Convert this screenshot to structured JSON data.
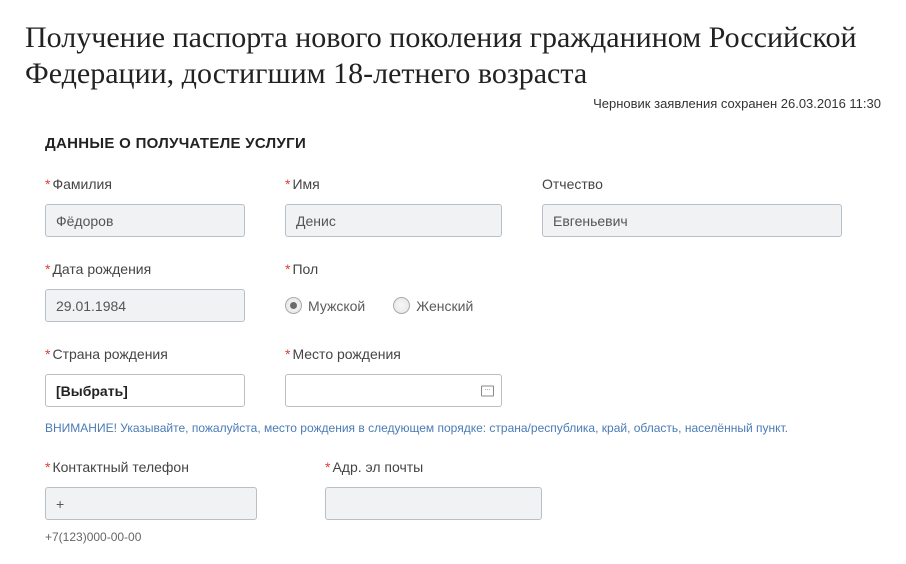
{
  "header": {
    "title": "Получение паспорта нового поколения гражданином Российской Федерации, достигшим 18-летнего возраста",
    "saved_note": "Черновик заявления сохранен 26.03.2016 11:30"
  },
  "section": {
    "title": "ДАННЫЕ О ПОЛУЧАТЕЛЕ УСЛУГИ"
  },
  "fields": {
    "surname": {
      "label": "Фамилия",
      "value": "Фёдоров"
    },
    "name": {
      "label": "Имя",
      "value": "Денис"
    },
    "patronymic": {
      "label": "Отчество",
      "value": "Евгеньевич"
    },
    "dob": {
      "label": "Дата рождения",
      "value": "29.01.1984"
    },
    "gender": {
      "label": "Пол",
      "options": {
        "male": "Мужской",
        "female": "Женский"
      },
      "value": "male"
    },
    "birth_country": {
      "label": "Страна рождения",
      "value": "[Выбрать]"
    },
    "birth_place": {
      "label": "Место рождения",
      "value": ""
    },
    "phone": {
      "label": "Контактный телефон",
      "value": "+",
      "hint": "+7(123)000-00-00"
    },
    "email": {
      "label": "Адр. эл почты",
      "value": ""
    }
  },
  "hints": {
    "birth_place": "ВНИМАНИЕ! Указывайте, пожалуйста, место рождения в следующем порядке: страна/республика, край, область, населённый пункт."
  }
}
